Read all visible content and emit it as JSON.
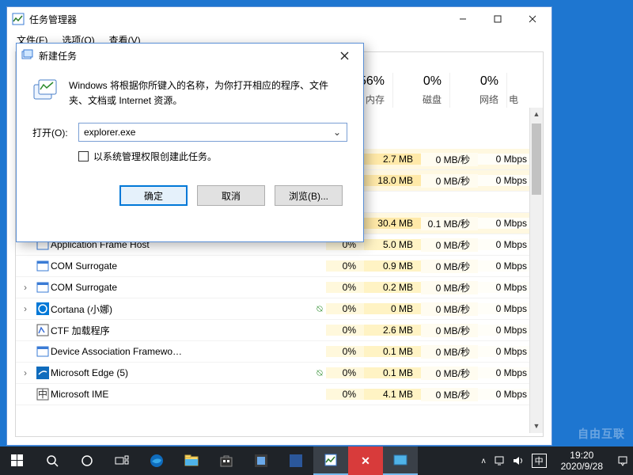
{
  "taskmgr": {
    "title": "任务管理器",
    "menu": {
      "file": "文件(F)",
      "options": "选项(O)",
      "view": "查看(V)"
    },
    "headers": {
      "cpu": {
        "pct": "56%",
        "label": "内存"
      },
      "mem": {
        "pct": "0%",
        "label": "磁盘"
      },
      "disk": {
        "pct": "0%",
        "label": "网络"
      },
      "extra": {
        "label": "电"
      }
    },
    "rows": [
      {
        "expand": "",
        "name": "",
        "leaf": "",
        "cpu": "",
        "mem": "2.7 MB",
        "disk": "0 MB/秒",
        "net": "0 Mbps",
        "sel": true
      },
      {
        "expand": "",
        "name": "",
        "leaf": "",
        "cpu": "",
        "mem": "18.0 MB",
        "disk": "0 MB/秒",
        "net": "0 Mbps",
        "sel": true
      },
      {
        "expand": "",
        "name": "",
        "leaf": "",
        "cpu": "",
        "mem": "",
        "disk": "",
        "net": "",
        "blank": true
      },
      {
        "expand": "",
        "name": "",
        "leaf": "",
        "cpu": "",
        "mem": "30.4 MB",
        "disk": "0.1 MB/秒",
        "net": "0 Mbps",
        "sel": true
      },
      {
        "expand": "",
        "name": "Application Frame Host",
        "leaf": "",
        "cpu": "0%",
        "mem": "5.0 MB",
        "disk": "0 MB/秒",
        "net": "0 Mbps",
        "icon": "app"
      },
      {
        "expand": "",
        "name": "COM Surrogate",
        "leaf": "",
        "cpu": "0%",
        "mem": "0.9 MB",
        "disk": "0 MB/秒",
        "net": "0 Mbps",
        "icon": "app"
      },
      {
        "expand": "›",
        "name": "COM Surrogate",
        "leaf": "",
        "cpu": "0%",
        "mem": "0.2 MB",
        "disk": "0 MB/秒",
        "net": "0 Mbps",
        "icon": "app"
      },
      {
        "expand": "›",
        "name": "Cortana (小娜)",
        "leaf": "⍉",
        "cpu": "0%",
        "mem": "0 MB",
        "disk": "0 MB/秒",
        "net": "0 Mbps",
        "icon": "cortana"
      },
      {
        "expand": "",
        "name": "CTF 加载程序",
        "leaf": "",
        "cpu": "0%",
        "mem": "2.6 MB",
        "disk": "0 MB/秒",
        "net": "0 Mbps",
        "icon": "ctf"
      },
      {
        "expand": "",
        "name": "Device Association Framewo…",
        "leaf": "",
        "cpu": "0%",
        "mem": "0.1 MB",
        "disk": "0 MB/秒",
        "net": "0 Mbps",
        "icon": "app"
      },
      {
        "expand": "›",
        "name": "Microsoft Edge (5)",
        "leaf": "⍉",
        "cpu": "0%",
        "mem": "0.1 MB",
        "disk": "0 MB/秒",
        "net": "0 Mbps",
        "icon": "edge"
      },
      {
        "expand": "",
        "name": "Microsoft IME",
        "leaf": "",
        "cpu": "0%",
        "mem": "4.1 MB",
        "disk": "0 MB/秒",
        "net": "0 Mbps",
        "icon": "ime"
      }
    ]
  },
  "dialog": {
    "title": "新建任务",
    "intro": "Windows 将根据你所键入的名称，为你打开相应的程序、文件夹、文档或 Internet 资源。",
    "open_label": "打开(O):",
    "open_value": "explorer.exe",
    "admin_label": "以系统管理权限创建此任务。",
    "ok": "确定",
    "cancel": "取消",
    "browse": "浏览(B)..."
  },
  "tray": {
    "ime": "中",
    "time": "19:20",
    "date": "2020/9/28"
  },
  "watermark": "自由互联"
}
